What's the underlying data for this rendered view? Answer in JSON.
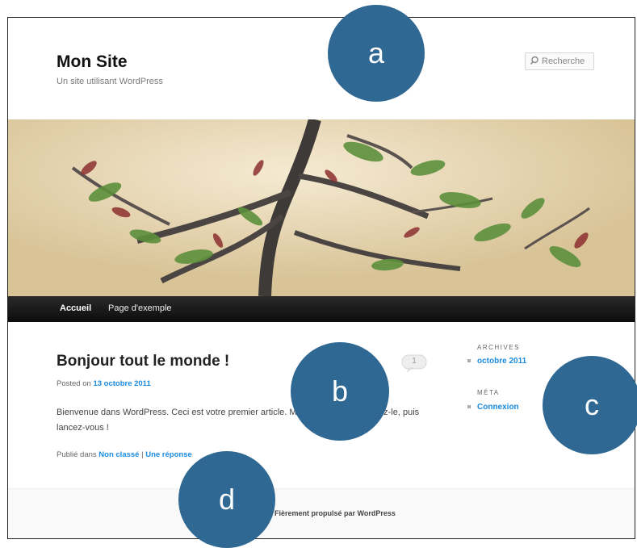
{
  "header": {
    "site_title": "Mon Site",
    "site_description": "Un site utilisant WordPress",
    "search_placeholder": "Recherche"
  },
  "nav": {
    "items": [
      {
        "label": "Accueil",
        "active": true
      },
      {
        "label": "Page d'exemple",
        "active": false
      }
    ]
  },
  "post": {
    "title": "Bonjour tout le monde !",
    "comment_count": "1",
    "posted_prefix": "Posted on",
    "posted_date": "13 octobre 2011",
    "body": "Bienvenue dans WordPress. Ceci est votre premier article. Modifiez-le ou supprimez-le, puis lancez-vous !",
    "published_prefix": "Publié dans",
    "category": "Non classé",
    "separator": "|",
    "reply_link": "Une réponse"
  },
  "sidebar": {
    "archives_title": "ARCHIVES",
    "archives_item": "octobre 2011",
    "meta_title": "MÉTA",
    "meta_item": "Connexion"
  },
  "footer": {
    "credit": "Fièrement propulsé par WordPress"
  },
  "markers": {
    "a": "a",
    "b": "b",
    "c": "c",
    "d": "d"
  },
  "colors": {
    "link": "#1b8be0",
    "marker": "#2f6892",
    "nav_bg": "#111111"
  }
}
